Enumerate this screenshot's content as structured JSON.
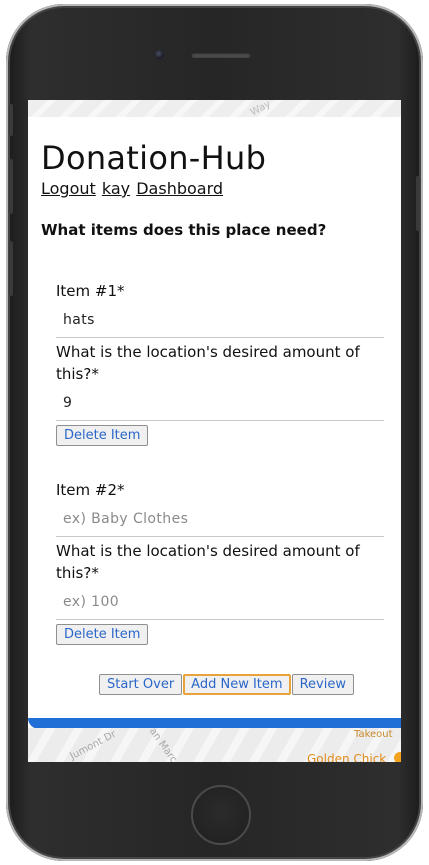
{
  "app": {
    "title": "Donation-Hub",
    "nav": {
      "logout": "Logout",
      "user": "kay",
      "dashboard": "Dashboard"
    }
  },
  "form": {
    "question": "What items does this place need?",
    "items": [
      {
        "item_label": "Item #1*",
        "item_value": "hats",
        "item_placeholder": "ex) Baby Clothes",
        "amount_label": "What is the location's desired amount of this?*",
        "amount_value": "9",
        "amount_placeholder": "ex) 100",
        "delete_label": "Delete Item"
      },
      {
        "item_label": "Item #2*",
        "item_value": "",
        "item_placeholder": "ex) Baby Clothes",
        "amount_label": "What is the location's desired amount of this?*",
        "amount_value": "",
        "amount_placeholder": "ex) 100",
        "delete_label": "Delete Item"
      }
    ],
    "actions": {
      "start_over": "Start Over",
      "add_new_item": "Add New Item",
      "review": "Review"
    }
  },
  "map": {
    "road_top": "Way",
    "street_a": "Jumont Dr",
    "street_b": "an Marc",
    "place_tag": "Takeout",
    "place_name": "Golden Chick"
  },
  "colors": {
    "accent_blue": "#1f6fd6",
    "button_text": "#2a67c9",
    "focus_ring": "#e8a33a"
  }
}
